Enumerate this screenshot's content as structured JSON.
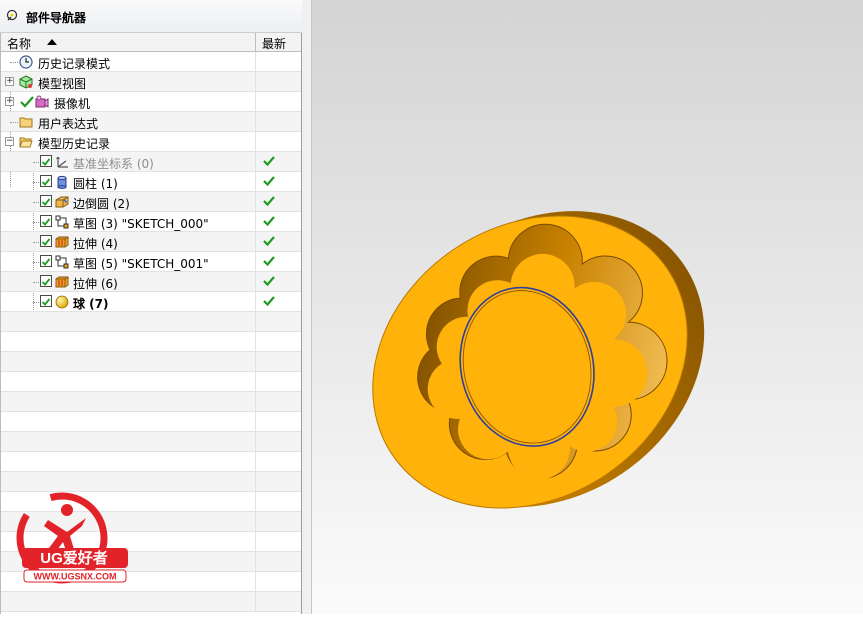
{
  "navigator": {
    "title": "部件导航器",
    "col_name": "名称",
    "col_latest": "最新"
  },
  "tree": [
    {
      "label": "历史记录模式",
      "icon": "clock-icon"
    },
    {
      "label": "模型视图",
      "icon": "model-views-icon"
    },
    {
      "label": "摄像机",
      "icon": "camera-icon"
    },
    {
      "label": "用户表达式",
      "icon": "folder-icon"
    },
    {
      "label": "模型历史记录",
      "icon": "folder-open-icon"
    },
    {
      "label": "基准坐标系 (0)",
      "icon": "datum-csys-icon",
      "latest": true
    },
    {
      "label": "圆柱 (1)",
      "icon": "cylinder-icon",
      "latest": true
    },
    {
      "label": "边倒圆 (2)",
      "icon": "edge-blend-icon",
      "latest": true
    },
    {
      "label": "草图 (3) \"SKETCH_000\"",
      "icon": "sketch-icon",
      "latest": true
    },
    {
      "label": "拉伸 (4)",
      "icon": "extrude-icon",
      "latest": true
    },
    {
      "label": "草图 (5) \"SKETCH_001\"",
      "icon": "sketch-icon",
      "latest": true
    },
    {
      "label": "拉伸 (6)",
      "icon": "extrude-icon",
      "latest": true
    },
    {
      "label": "球 (7)",
      "icon": "sphere-icon",
      "latest": true
    }
  ],
  "watermark": {
    "brand": "UG爱好者",
    "url": "WWW.UGSNX.COM"
  },
  "colors": {
    "part_fill": "#ffb20a",
    "part_edge": "#2f3f9e",
    "check": "#1f9b1f",
    "watermark_red": "#e2232a"
  }
}
